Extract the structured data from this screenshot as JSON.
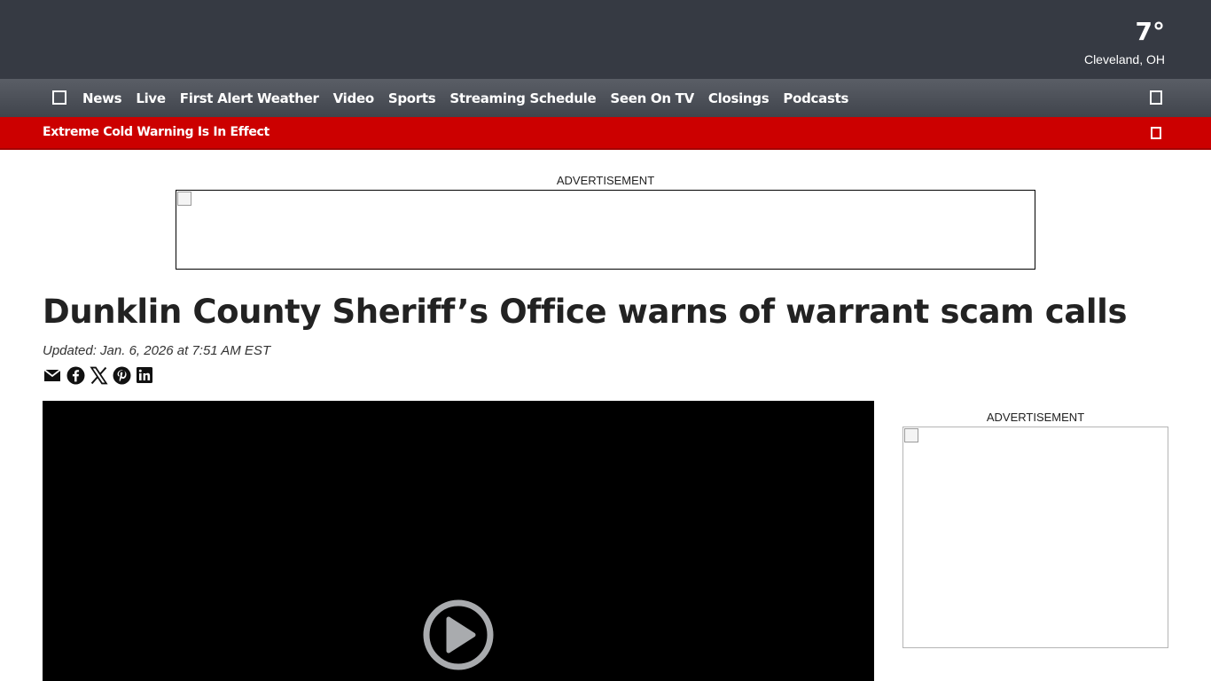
{
  "weather": {
    "temperature": "7°",
    "location": "Cleveland, OH"
  },
  "nav": {
    "menu_icon": "menu-icon",
    "items": [
      "News",
      "Live",
      "First Alert Weather",
      "Video",
      "Sports",
      "Streaming Schedule",
      "Seen On TV",
      "Closings",
      "Podcasts"
    ],
    "search_icon": "search-icon"
  },
  "alert": {
    "text": "Extreme Cold Warning Is In Effect",
    "close_icon": "close-icon"
  },
  "ads": {
    "label": "ADVERTISEMENT"
  },
  "article": {
    "headline": "Dunklin County Sheriff’s Office warns of warrant scam calls",
    "updated": "Updated: Jan. 6, 2026 at 7:51 AM EST",
    "share_icons": [
      "email-icon",
      "facebook-icon",
      "x-icon",
      "pinterest-icon",
      "linkedin-icon"
    ]
  },
  "video": {
    "play_icon": "play-icon"
  },
  "colors": {
    "topbar": "#363a43",
    "alert": "#cc0000",
    "video_bg": "#000000",
    "play": "#a9abae"
  }
}
